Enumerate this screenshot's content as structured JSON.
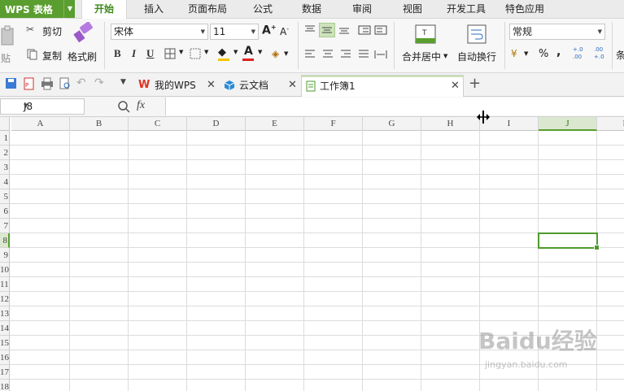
{
  "app": {
    "name": "WPS 表格"
  },
  "menu": {
    "tabs": [
      "开始",
      "插入",
      "页面布局",
      "公式",
      "数据",
      "审阅",
      "视图",
      "开发工具",
      "特色应用"
    ],
    "active_index": 0
  },
  "ribbon": {
    "paste_label": "贴",
    "cut_label": "剪切",
    "copy_label": "复制",
    "format_painter_label": "格式刷",
    "font_name": "宋体",
    "font_size": "11",
    "bold": "B",
    "italic": "I",
    "underline": "U",
    "font_color_letter": "A",
    "merge_label": "合并居中",
    "wrap_label": "自动换行",
    "number_format": "常规",
    "percent": "%",
    "comma": ",",
    "inc_decimal": "+.0 .00",
    "dec_decimal": ".00 +.0",
    "more_label": "条"
  },
  "tabs": [
    {
      "label": "我的WPS",
      "icon": "wps-logo-icon"
    },
    {
      "label": "云文档",
      "icon": "cloud-doc-icon"
    },
    {
      "label": "工作簿1",
      "icon": "workbook-icon",
      "active": true
    }
  ],
  "formula_bar": {
    "name_box": "J8",
    "fx": "fx",
    "value": ""
  },
  "grid": {
    "columns": [
      "A",
      "B",
      "C",
      "D",
      "E",
      "F",
      "G",
      "H",
      "I",
      "J",
      "K"
    ],
    "rows": [
      "1",
      "2",
      "3",
      "4",
      "5",
      "6",
      "7",
      "8",
      "9",
      "10",
      "11",
      "12",
      "13",
      "14",
      "15",
      "16",
      "17",
      "18"
    ],
    "selected_column": "J",
    "selected_row": "8",
    "selected_cell": "J8"
  },
  "watermark": {
    "text": "Baidu经验",
    "url": "jingyan.baidu.com"
  },
  "colors": {
    "accent": "#5a9e2f",
    "menu_bg": "#ebebeb",
    "grid_line": "#dcdcdc"
  }
}
